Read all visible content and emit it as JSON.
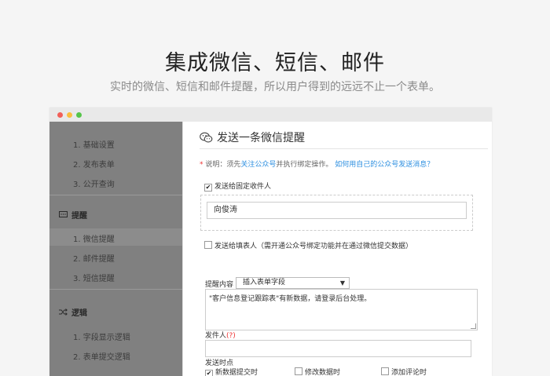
{
  "hero": {
    "title": "集成微信、短信、邮件",
    "subtitle": "实时的微信、短信和邮件提醒，所以用户得到的远远不止一个表单。"
  },
  "sidebar": {
    "group1_items": [
      "1. 基础设置",
      "2. 发布表单",
      "3. 公开查询"
    ],
    "group2": {
      "icon": "message-box-icon",
      "label": "提醒",
      "items": [
        "1. 微信提醒",
        "2. 邮件提醒",
        "3. 短信提醒"
      ],
      "active_index": 0
    },
    "group3": {
      "icon": "shuffle-icon",
      "label": "逻辑",
      "items": [
        "1. 字段显示逻辑",
        "2. 表单提交逻辑"
      ]
    }
  },
  "main": {
    "title": "发送一条微信提醒",
    "note": {
      "asterisk": "*",
      "prefix": "说明：须先",
      "link1": "关注公众号",
      "middle": "并执行绑定操作。",
      "link2": "如何用自己的公众号发送消息？"
    },
    "fixed_recipient": {
      "label": "发送给固定收件人",
      "checked": true,
      "value": "向俊涛"
    },
    "form_filler": {
      "label": "发送给填表人（需开通公众号绑定功能并在通过微信提交数据）",
      "checked": false
    },
    "content_label": "提醒内容",
    "insert_field": {
      "selected": "插入表单字段",
      "arrow": "▼"
    },
    "content_text": "\"客户信息登记跟踪表\"有新数据，请登录后台处理。",
    "sender_label": "发件人",
    "sender_help": "(?)",
    "send_time_label": "发送时点",
    "send_time_options": [
      {
        "label": "新数据提交时",
        "checked": true
      },
      {
        "label": "修改数据时",
        "checked": false
      },
      {
        "label": "添加评论时",
        "checked": false
      }
    ]
  },
  "colors": {
    "link": "#2d8fe0",
    "required": "#e33333",
    "sidebar_bg": "#808080"
  }
}
